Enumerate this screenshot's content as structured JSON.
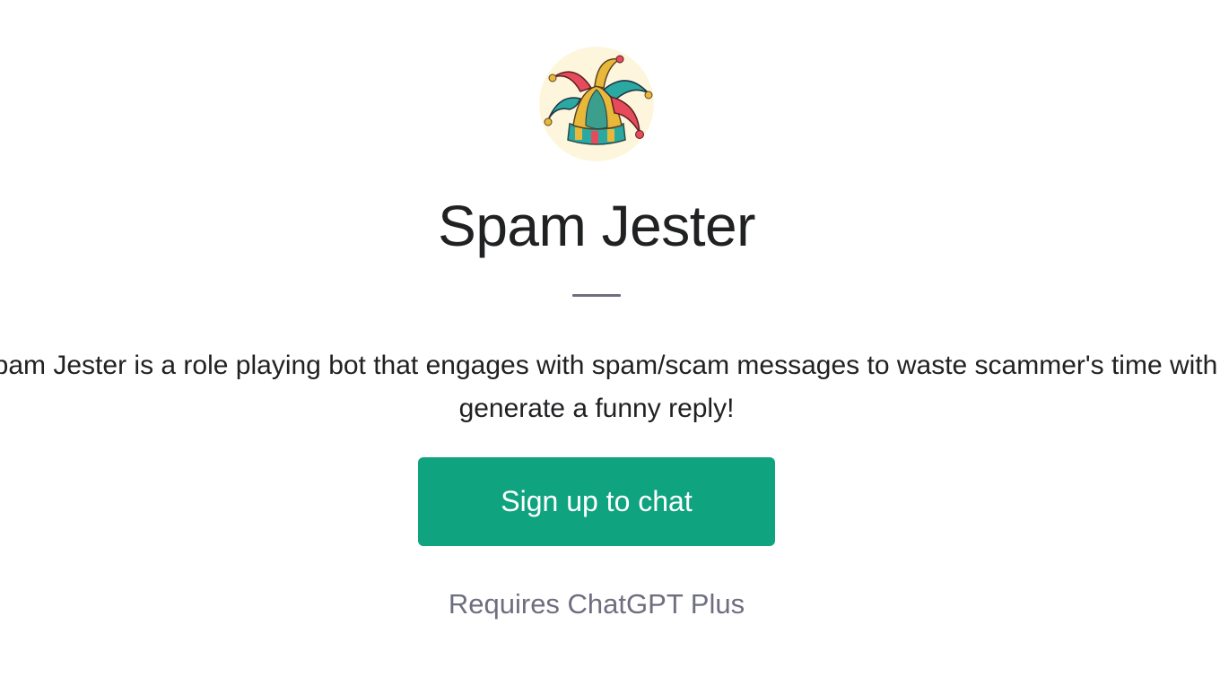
{
  "gpt": {
    "avatar_icon": "jester-hat-icon",
    "name": "Spam Jester",
    "description_lines": [
      "Spam Jester is a role playing bot that engages with spam/scam messages to waste scammer's time with",
      "generate a funny reply!"
    ]
  },
  "actions": {
    "signup_label": "Sign up to chat",
    "requirement_note": "Requires ChatGPT Plus"
  },
  "colors": {
    "accent": "#10a37f",
    "muted_text": "#6e6e80",
    "primary_text": "#202123"
  }
}
